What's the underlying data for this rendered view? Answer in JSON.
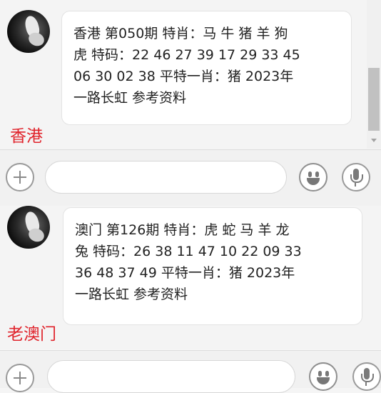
{
  "conversations": [
    {
      "region": "香港",
      "message": "香港 第050期 特肖：马 牛 猪 羊 狗\n虎 特码：22 46 27 39 17 29 33 45\n06 30 02 38 平特一肖：猪 2023年\n一路长虹 参考资料"
    },
    {
      "region": "老澳门",
      "message": "澳门 第126期 特肖：虎 蛇 马 羊 龙\n兔 特码：26 38 11 47 10 22 09 33\n36 48 37 49 平特一肖：猪 2023年\n一路长虹 参考资料"
    }
  ],
  "input_bar": {
    "text_value": "",
    "icons": [
      "plus-icon",
      "emoji-icon",
      "microphone-icon"
    ]
  },
  "colors": {
    "region_label": "#e0232b",
    "bubble_bg": "#ffffff",
    "page_bg": "#f5f5f5"
  }
}
